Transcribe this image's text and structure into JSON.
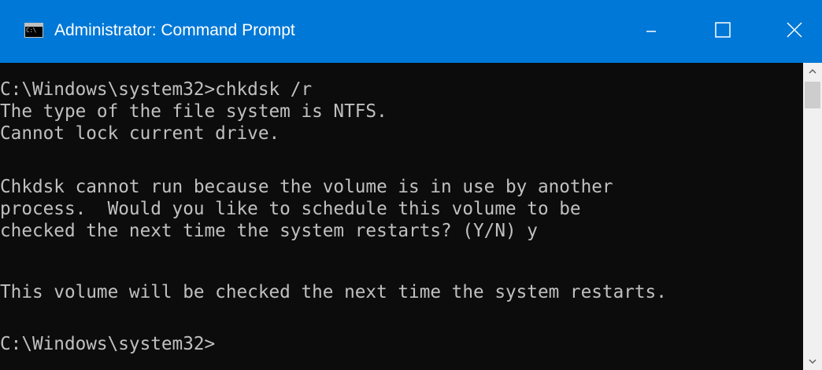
{
  "window": {
    "title": "Administrator: Command Prompt",
    "app_icon_text": "C:\\",
    "controls": {
      "minimize": "minimize-icon",
      "maximize": "maximize-icon",
      "close": "close-icon"
    },
    "accent_color": "#0078d7"
  },
  "console": {
    "foreground": "#c0c0c0",
    "background": "#0c0c0c",
    "lines": [
      "C:\\Windows\\system32>chkdsk /r",
      "The type of the file system is NTFS.",
      "Cannot lock current drive.",
      "",
      "Chkdsk cannot run because the volume is in use by another",
      "process.  Would you like to schedule this volume to be",
      "checked the next time the system restarts? (Y/N) y",
      "",
      "This volume will be checked the next time the system restarts.",
      "",
      "C:\\Windows\\system32>"
    ]
  },
  "scrollbar": {
    "up_icon": "chevron-up-icon",
    "down_icon": "chevron-down-icon"
  }
}
